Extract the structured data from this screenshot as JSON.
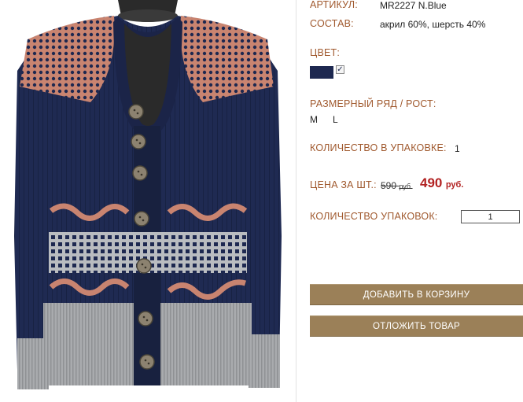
{
  "product": {
    "article_label": "АРТИКУЛ:",
    "article_value": "MR2227 N.Blue",
    "composition_label": "СОСТАВ:",
    "composition_value": "акрил 60%, шерсть 40%",
    "color_label": "ЦВЕТ:",
    "color_swatch": "#1d2850",
    "color_checked": "✓",
    "size_label": "РАЗМЕРНЫЙ РЯД / РОСТ:",
    "sizes": [
      "M",
      "L"
    ],
    "pack_qty_label": "КОЛИЧЕСТВО В УПАКОВКЕ:",
    "pack_qty_value": "1",
    "price_label": "ЦЕНА ЗА ШТ.:",
    "old_price": "590",
    "old_currency": "руб.",
    "new_price": "490",
    "new_currency": "руб.",
    "packs_label": "КОЛИЧЕСТВО УПАКОВОК:",
    "packs_value": "1"
  },
  "actions": {
    "add_to_cart": "ДОБАВИТЬ В КОРЗИНУ",
    "save_item": "ОТЛОЖИТЬ ТОВАР"
  },
  "colors": {
    "label": "#a0592e",
    "price": "#b22222",
    "button": "#9b8058",
    "sweater_navy": "#1d2850"
  },
  "image": {
    "icon": "navy-knit-cardigan-photo"
  }
}
